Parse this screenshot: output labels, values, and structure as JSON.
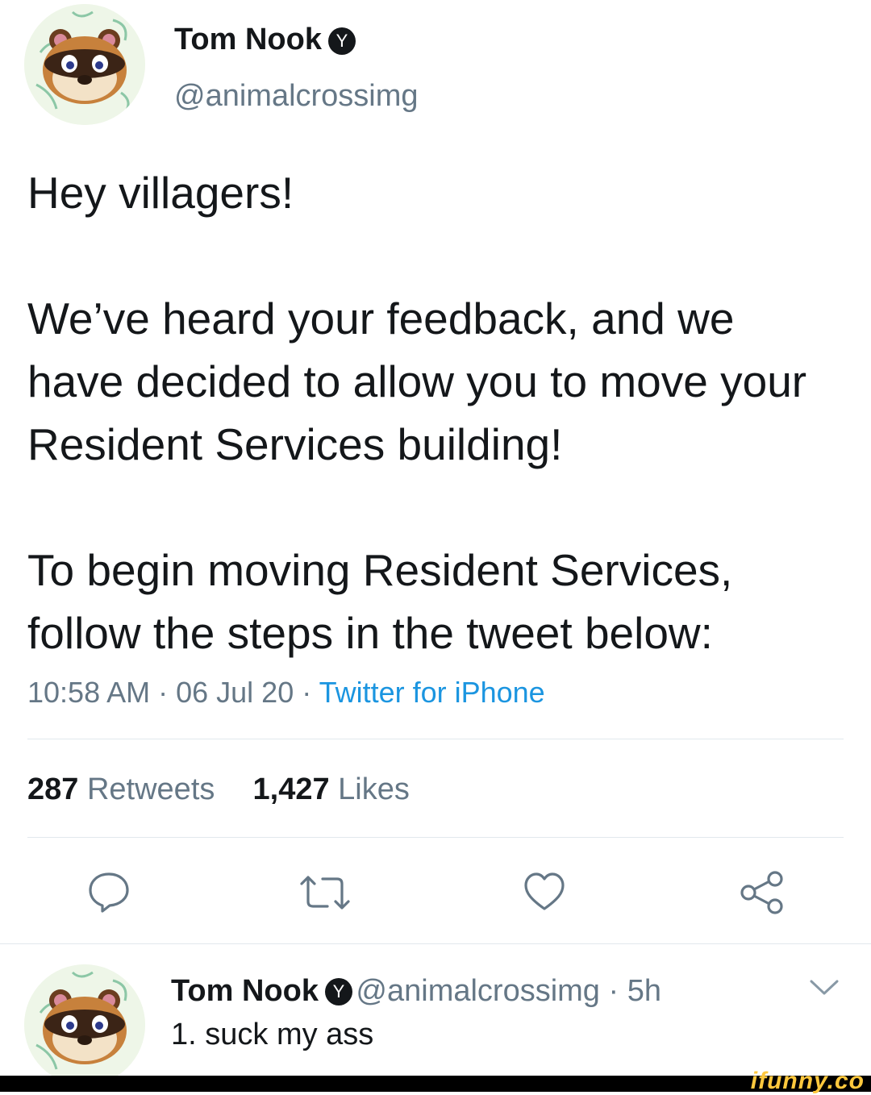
{
  "tweet": {
    "author_name": "Tom Nook",
    "verified_glyph": "Y",
    "handle": "@animalcrossimg",
    "paragraphs": [
      "Hey villagers!",
      "We’ve heard your feedback, and we have decided to allow you to move your Resident Services building!",
      "To begin moving Resident Services, follow the steps in the tweet below:"
    ],
    "time": "10:58 AM",
    "date": "06 Jul 20",
    "separator": " · ",
    "source": "Twitter for iPhone",
    "retweet_count": "287",
    "retweet_label": "Retweets",
    "like_count": "1,427",
    "like_label": "Likes"
  },
  "actions": [
    {
      "name": "reply-icon"
    },
    {
      "name": "retweet-icon"
    },
    {
      "name": "like-icon"
    },
    {
      "name": "share-icon"
    }
  ],
  "reply": {
    "author_name": "Tom Nook",
    "verified_glyph": "Y",
    "handle": "@animalcrossimg",
    "time_ago": "5h",
    "separator": " · ",
    "text": "1. suck my ass"
  },
  "watermark": "ifunny.co",
  "colors": {
    "text": "#14171a",
    "secondary": "#657786",
    "link": "#1b95e0",
    "divider": "#e1e8ed"
  }
}
